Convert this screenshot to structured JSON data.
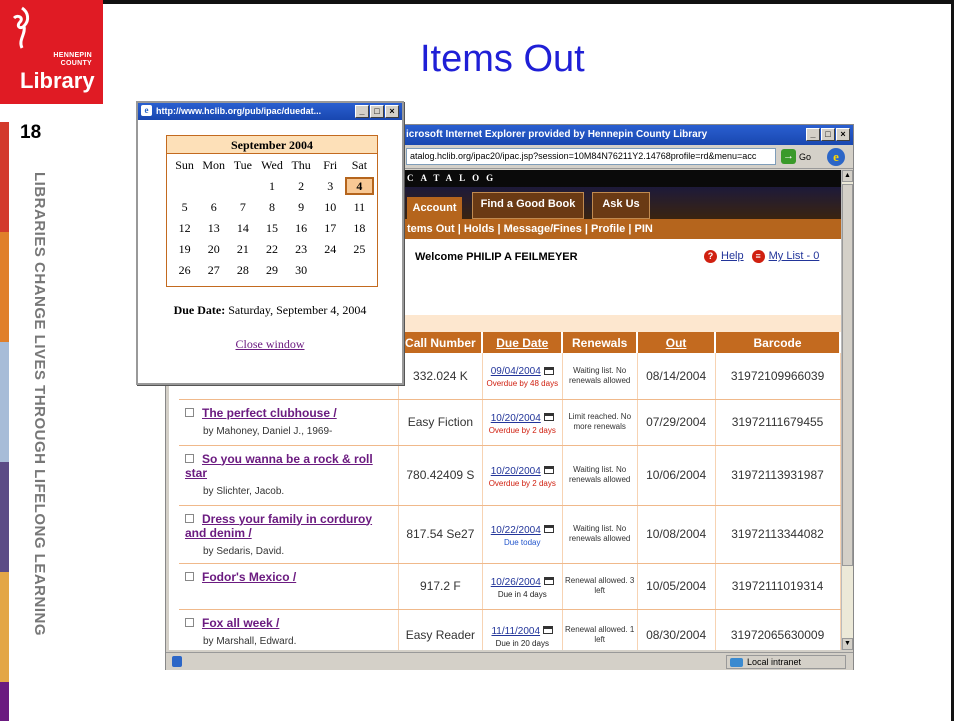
{
  "slide": {
    "title": "Items Out",
    "number": "18",
    "logo_small": "HENNEPIN\nCOUNTY",
    "logo_main": "Library",
    "vertical_text": "LIBRARIES CHANGE LIVES THROUGH LIFELONG LEARNING",
    "stripe_colors": [
      "#d33a2c",
      "#e07f2a",
      "#a7bcd8",
      "#5b4b86",
      "#e3a646",
      "#6b1b80"
    ]
  },
  "browser": {
    "title": "icrosoft Internet Explorer provided by Hennepin County Library",
    "address": "atalog.hclib.org/ipac20/ipac.jsp?session=10M84N76211Y2.14768profile=rd&menu=acc",
    "go_label": "Go",
    "status_zone": "Local intranet",
    "catalog_label": "CATALOG",
    "tabs": [
      "Account",
      "Find a Good Book",
      "Ask Us"
    ],
    "subnav": "tems Out | Holds | Message/Fines | Profile | PIN",
    "welcome": "Welcome PHILIP A FEILMEYER",
    "help": "Help",
    "mylist": "My List - 0",
    "columns": [
      "Call Number",
      "Due Date",
      "Renewals",
      "Out",
      "Barcode"
    ],
    "rows": [
      {
        "title": "",
        "author": "",
        "call": "332.024 K",
        "due": "09/04/2004",
        "due_status": "Overdue by 48 days",
        "status_color": "#d02010",
        "renewals": "Waiting list. No renewals allowed",
        "out": "08/14/2004",
        "barcode": "31972109966039"
      },
      {
        "title": "The perfect clubhouse /",
        "author": "by Mahoney, Daniel J., 1969-",
        "call": "Easy Fiction",
        "due": "10/20/2004",
        "due_status": "Overdue by 2 days",
        "status_color": "#d02010",
        "renewals": "Limit reached. No more renewals",
        "out": "07/29/2004",
        "barcode": "31972111679455"
      },
      {
        "title": "So you wanna be a rock & roll star",
        "author": "by Slichter, Jacob.",
        "call": "780.42409 S",
        "due": "10/20/2004",
        "due_status": "Overdue by 2 days",
        "status_color": "#d02010",
        "renewals": "Waiting list. No renewals allowed",
        "out": "10/06/2004",
        "barcode": "31972113931987"
      },
      {
        "title": "Dress your family in corduroy and denim /",
        "author": "by Sedaris, David.",
        "call": "817.54 Se27",
        "due": "10/22/2004",
        "due_status": "Due today",
        "status_color": "#2255cc",
        "renewals": "Waiting list. No renewals allowed",
        "out": "10/08/2004",
        "barcode": "31972113344082"
      },
      {
        "title": "Fodor's Mexico /",
        "author": "",
        "call": "917.2 F",
        "due": "10/26/2004",
        "due_status": "Due in 4 days",
        "status_color": "#222222",
        "renewals": "Renewal allowed. 3 left",
        "out": "10/05/2004",
        "barcode": "31972111019314"
      },
      {
        "title": "Fox all week /",
        "author": "by Marshall, Edward.",
        "call": "Easy Reader",
        "due": "11/11/2004",
        "due_status": "Due in 20 days",
        "status_color": "#222222",
        "renewals": "Renewal allowed. 1 left",
        "out": "08/30/2004",
        "barcode": "31972065630009"
      }
    ]
  },
  "popup": {
    "title": "http://www.hclib.org/pub/ipac/duedat...",
    "month": "September 2004",
    "weekdays": [
      "Sun",
      "Mon",
      "Tue",
      "Wed",
      "Thu",
      "Fri",
      "Sat"
    ],
    "days": [
      "",
      "",
      "",
      "1",
      "2",
      "3",
      "4",
      "5",
      "6",
      "7",
      "8",
      "9",
      "10",
      "11",
      "12",
      "13",
      "14",
      "15",
      "16",
      "17",
      "18",
      "19",
      "20",
      "21",
      "22",
      "23",
      "24",
      "25",
      "26",
      "27",
      "28",
      "29",
      "30",
      "",
      ""
    ],
    "selected_day": "4",
    "due_label": "Due Date:",
    "due_value": "Saturday, September 4, 2004",
    "close_label": "Close window"
  }
}
